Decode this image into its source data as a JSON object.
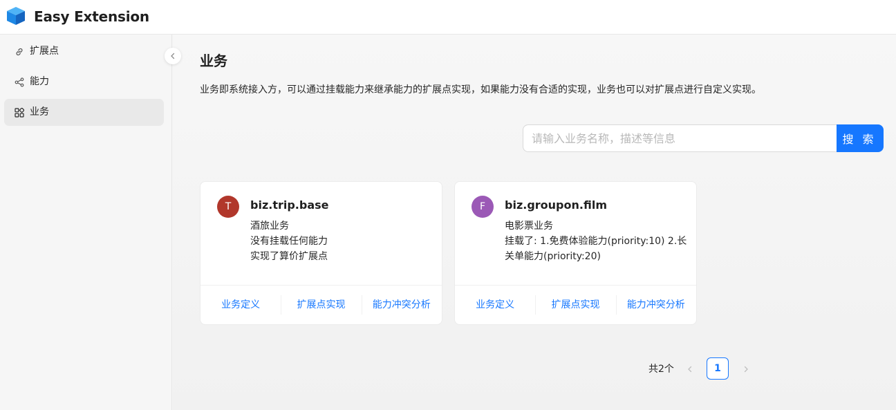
{
  "app": {
    "title": "Easy Extension"
  },
  "sidebar": {
    "items": [
      {
        "label": "扩展点",
        "icon": "link-icon"
      },
      {
        "label": "能力",
        "icon": "share-icon"
      },
      {
        "label": "业务",
        "icon": "appstore-icon",
        "active": true
      }
    ]
  },
  "page": {
    "title": "业务",
    "description": "业务即系统接入方，可以通过挂载能力来继承能力的扩展点实现，如果能力没有合适的实现，业务也可以对扩展点进行自定义实现。"
  },
  "search": {
    "placeholder": "请输入业务名称，描述等信息",
    "button_label": "搜 索"
  },
  "cards": [
    {
      "avatar_letter": "T",
      "avatar_color": "#b1372b",
      "title": "biz.trip.base",
      "description_lines": [
        "酒旅业务",
        "没有挂载任何能力",
        "实现了算价扩展点"
      ],
      "actions": [
        "业务定义",
        "扩展点实现",
        "能力冲突分析"
      ]
    },
    {
      "avatar_letter": "F",
      "avatar_color": "#9b59b6",
      "title": "biz.groupon.film",
      "description_lines": [
        "电影票业务",
        "挂载了: 1.免费体验能力(priority:10) 2.长",
        "关单能力(priority:20)"
      ],
      "actions": [
        "业务定义",
        "扩展点实现",
        "能力冲突分析"
      ]
    }
  ],
  "pagination": {
    "total_text": "共2个",
    "current_page": "1"
  },
  "colors": {
    "primary": "#1677ff",
    "logo": "#1e88e5"
  }
}
